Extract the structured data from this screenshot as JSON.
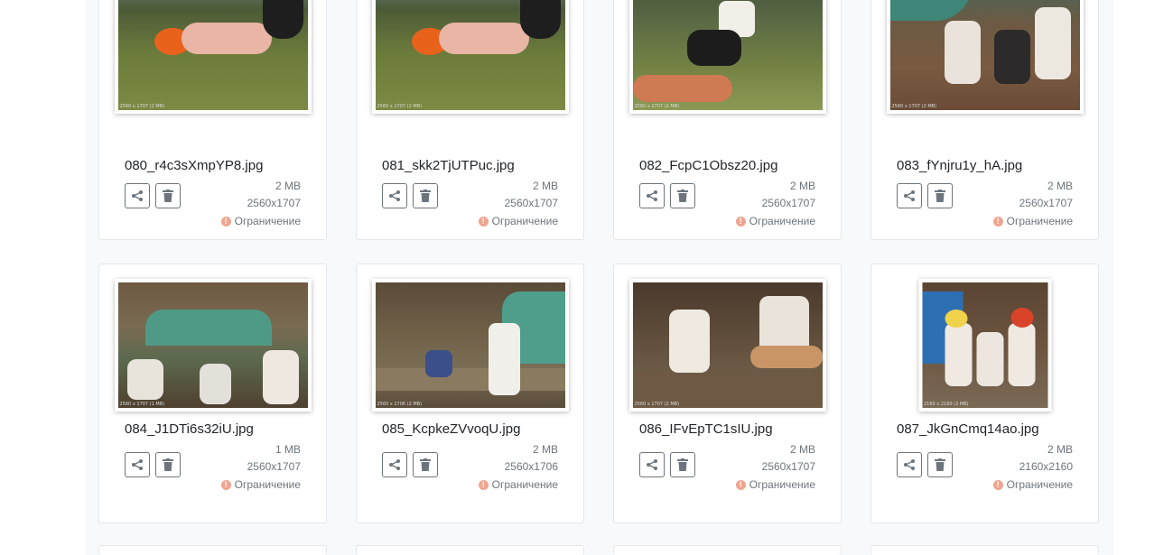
{
  "files": [
    {
      "name": "080_r4c3sXmpYP8.jpg",
      "size": "2 MB",
      "dims": "2560x1707",
      "restriction": "Ограничение",
      "watermark": "2560 x 1707 (2 MB)"
    },
    {
      "name": "081_skk2TjUTPuc.jpg",
      "size": "2 MB",
      "dims": "2560x1707",
      "restriction": "Ограничение",
      "watermark": "2560 x 1707 (2 MB)"
    },
    {
      "name": "082_FcpC1Obsz20.jpg",
      "size": "2 MB",
      "dims": "2560x1707",
      "restriction": "Ограничение",
      "watermark": "2560 x 1707 (2 MB)"
    },
    {
      "name": "083_fYnjru1y_hA.jpg",
      "size": "2 MB",
      "dims": "2560x1707",
      "restriction": "Ограничение",
      "watermark": "2560 x 1707 (2 MB)"
    },
    {
      "name": "084_J1DTi6s32iU.jpg",
      "size": "1 MB",
      "dims": "2560x1707",
      "restriction": "Ограничение",
      "watermark": "2560 x 1707 (1 MB)"
    },
    {
      "name": "085_KcpkeZVvoqU.jpg",
      "size": "2 MB",
      "dims": "2560x1706",
      "restriction": "Ограничение",
      "watermark": "2560 x 1706 (2 MB)"
    },
    {
      "name": "086_IFvEpTC1sIU.jpg",
      "size": "2 MB",
      "dims": "2560x1707",
      "restriction": "Ограничение",
      "watermark": "2560 x 1707 (2 MB)"
    },
    {
      "name": "087_JkGnCmq14ao.jpg",
      "size": "2 MB",
      "dims": "2160x2160",
      "restriction": "Ограничение",
      "watermark": "2160 x 2160 (2 MB)"
    }
  ],
  "icons": {
    "share": "share-icon",
    "delete": "trash-icon",
    "warning": "exclamation-circle-icon"
  },
  "colors": {
    "warning": "#f0a48f",
    "button_border": "#6c757d",
    "text_muted": "#6c757d"
  }
}
